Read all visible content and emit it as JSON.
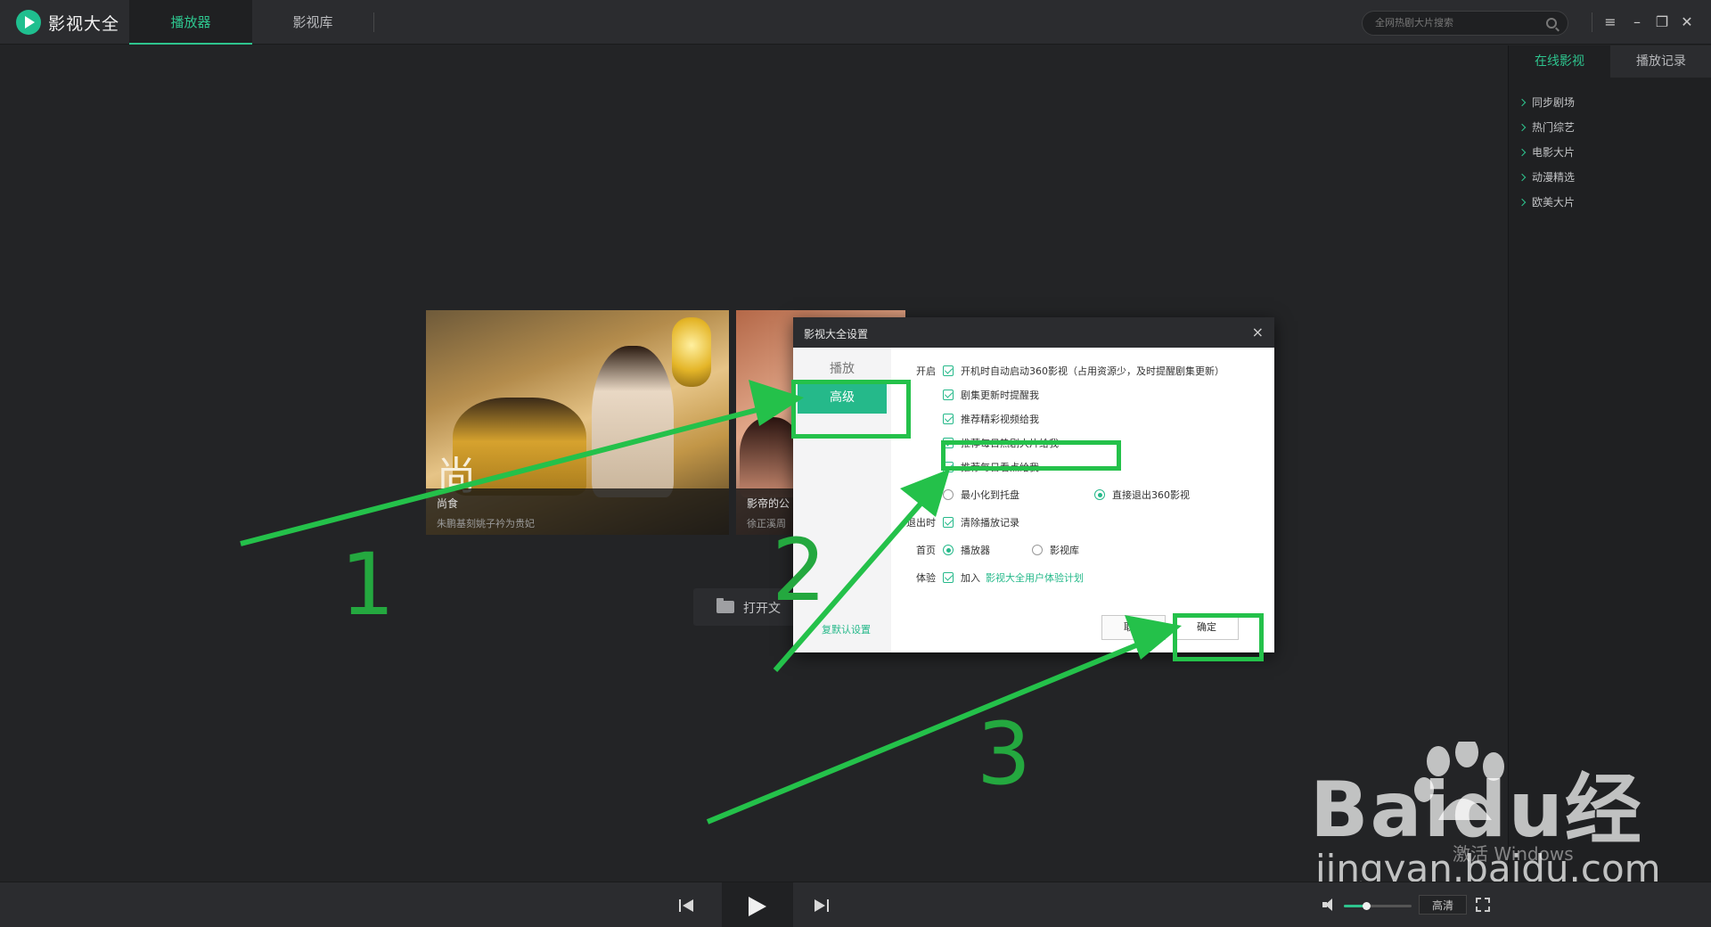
{
  "app": {
    "name": "影视大全",
    "tabs": [
      {
        "label": "播放器",
        "active": true
      },
      {
        "label": "影视库",
        "active": false
      }
    ],
    "search_placeholder": "全网热剧大片搜索",
    "accent_color": "#2ec48e"
  },
  "window_controls": [
    "menu-icon",
    "minimize-icon",
    "restore-icon",
    "close-icon"
  ],
  "right_panel": {
    "tabs": [
      {
        "label": "在线影视",
        "active": true
      },
      {
        "label": "播放记录",
        "active": false
      }
    ],
    "items": [
      "同步剧场",
      "热门综艺",
      "电影大片",
      "动漫精选",
      "欧美大片"
    ]
  },
  "cards": [
    {
      "glyph": "尚",
      "title": "尚食",
      "subtitle": "朱鹏基刻姚子衿为贵妃"
    },
    {
      "title": "影帝的公",
      "subtitle": "徐正溪周"
    }
  ],
  "open_button": {
    "label": "打开文"
  },
  "dialog": {
    "title": "影视大全设置",
    "close": "×",
    "sidebar": [
      {
        "label": "播放",
        "active": false
      },
      {
        "label": "高级",
        "active": true
      }
    ],
    "rows": [
      {
        "label": "开启",
        "type": "checkbox",
        "checked": true,
        "text": "开机时自动启动360影视（占用资源少，及时提醒剧集更新）"
      },
      {
        "label": "",
        "type": "checkbox",
        "checked": true,
        "text": "剧集更新时提醒我"
      },
      {
        "label": "",
        "type": "checkbox",
        "checked": true,
        "text": "推荐精彩视频给我"
      },
      {
        "label": "",
        "type": "checkbox",
        "checked": true,
        "text": "推荐每日热剧大片给我"
      },
      {
        "label": "",
        "type": "checkbox",
        "checked": true,
        "text": "推荐每日看点给我"
      }
    ],
    "close_options": [
      {
        "text": "最小化到托盘",
        "selected": false
      },
      {
        "text": "直接退出360影视",
        "selected": true
      }
    ],
    "exit_label": "退出时",
    "exit_option": "清除播放记录",
    "home_label": "首页",
    "home_options": [
      {
        "text": "播放器",
        "selected": true
      },
      {
        "text": "影视库",
        "selected": false
      }
    ],
    "experience_label": "体验",
    "experience_prefix": "加入",
    "experience_link": "影视大全用户体验计划",
    "restore_defaults": "复默认设置",
    "cancel_label": "取消",
    "ok_label": "确定"
  },
  "annotations": {
    "numbers": [
      "1",
      "2",
      "3"
    ],
    "highlight_color": "#24c14a"
  },
  "player": {
    "quality": "高清",
    "volume_fraction": 0.33
  },
  "watermark": {
    "brand": "Baidu经验",
    "url": "jingyan.baidu.com",
    "activation": "激活 Windows"
  }
}
